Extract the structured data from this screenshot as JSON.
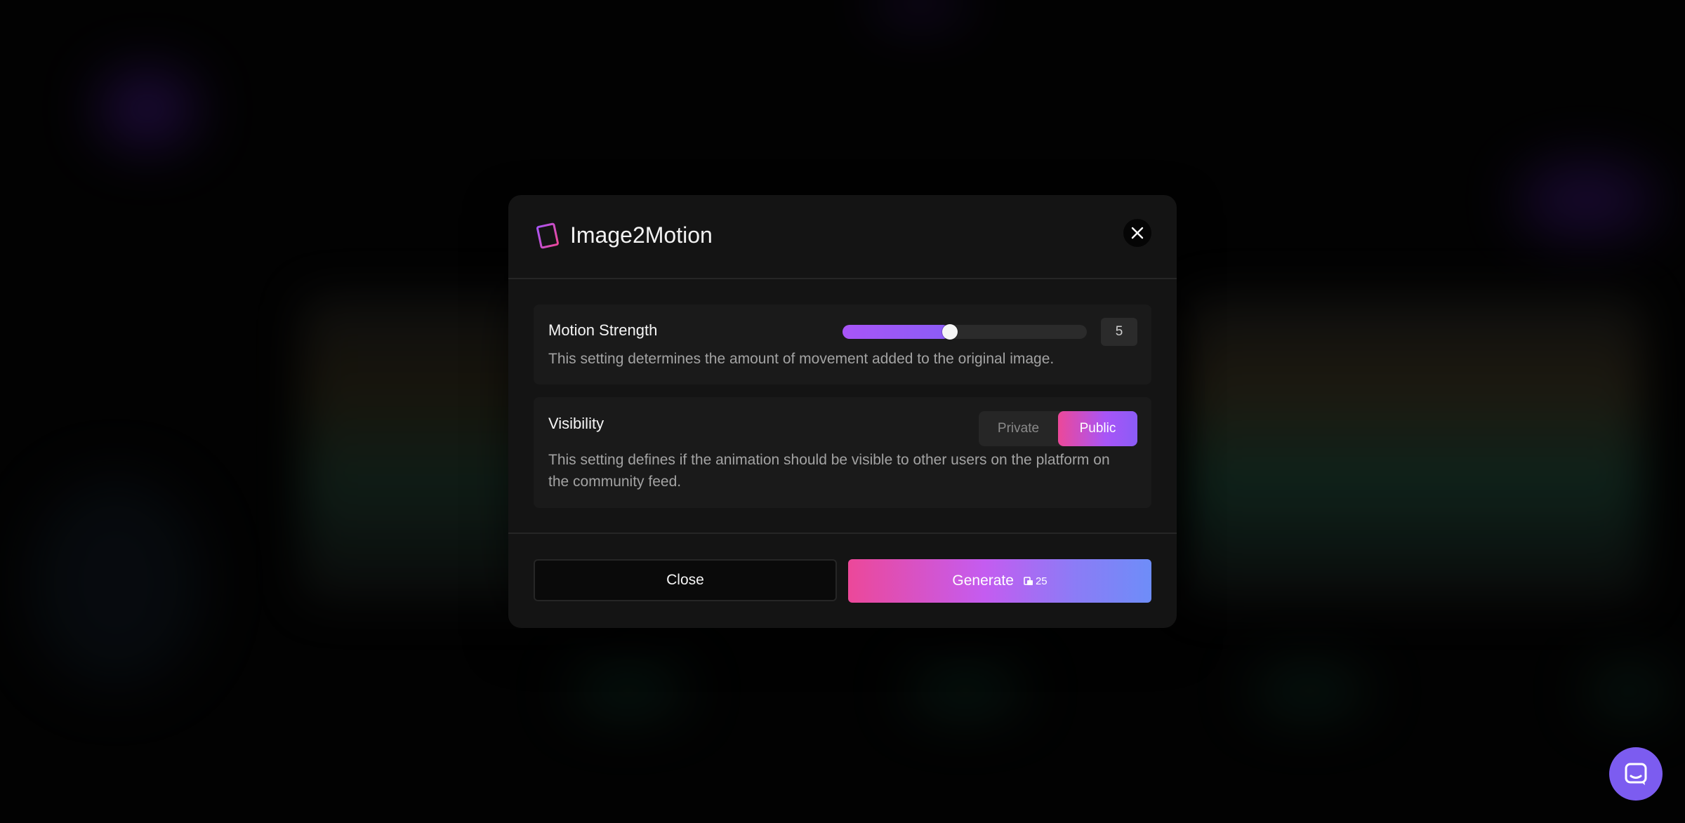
{
  "modal": {
    "title": "Image2Motion",
    "title_icon": "film-icon",
    "close_icon": "close-icon"
  },
  "motion_strength": {
    "label": "Motion Strength",
    "value": "5",
    "slider_fraction": 0.44,
    "description": "This setting determines the amount of movement added to the original image."
  },
  "visibility": {
    "label": "Visibility",
    "options": [
      "Private",
      "Public"
    ],
    "selected": "Public",
    "description": "This setting defines if the animation should be visible to other users on the platform on the community feed."
  },
  "footer": {
    "close_label": "Close",
    "generate_label": "Generate",
    "credit_cost": "25",
    "credit_icon": "coin-stack-icon"
  },
  "chat": {
    "icon": "chat-icon"
  },
  "colors": {
    "accent_pink": "#ec4899",
    "accent_purple": "#a855f7",
    "accent_blue": "#6e8df8",
    "chat_bubble": "#7c5cf0"
  }
}
